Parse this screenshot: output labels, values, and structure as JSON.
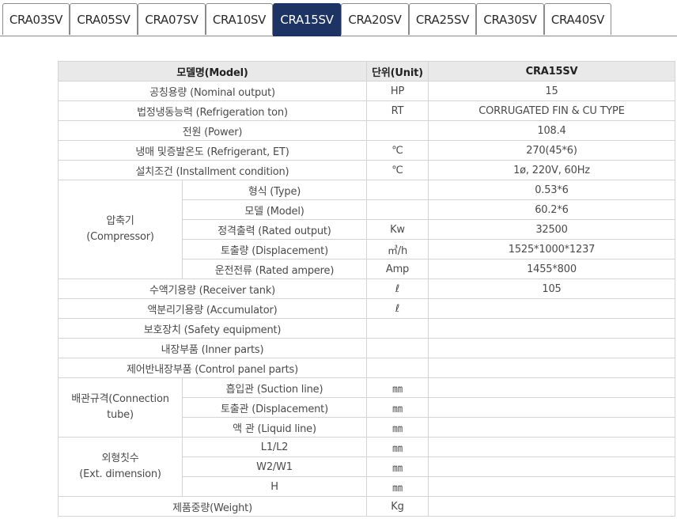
{
  "tabs": [
    {
      "label": "CRA03SV",
      "active": false
    },
    {
      "label": "CRA05SV",
      "active": false
    },
    {
      "label": "CRA07SV",
      "active": false
    },
    {
      "label": "CRA10SV",
      "active": false
    },
    {
      "label": "CRA15SV",
      "active": true
    },
    {
      "label": "CRA20SV",
      "active": false
    },
    {
      "label": "CRA25SV",
      "active": false
    },
    {
      "label": "CRA30SV",
      "active": false
    },
    {
      "label": "CRA40SV",
      "active": false
    }
  ],
  "colors": {
    "active_tab": "#1c3363",
    "header_bg": "#e9e9e9",
    "border": "#d4d4d4"
  },
  "table": {
    "header": {
      "model": "모델명(Model)",
      "unit": "단위(Unit)",
      "value": "CRA15SV"
    },
    "rows": [
      {
        "label": "공칭용량 (Nominal output)",
        "unit": "HP",
        "value": "15"
      },
      {
        "label": "법정냉동능력 (Refrigeration ton)",
        "unit": "RT",
        "value": "CORRUGATED FIN & CU TYPE"
      },
      {
        "label": "전원 (Power)",
        "unit": "",
        "value": "108.4"
      },
      {
        "label": "냉매 및증발온도 (Refrigerant, ET)",
        "unit": "℃",
        "value": "270(45*6)"
      },
      {
        "label": "설치조건 (Installment condition)",
        "unit": "℃",
        "value": "1ø, 220V, 60Hz"
      },
      {
        "group": "압축기\n(Compressor)",
        "label": "형식 (Type)",
        "unit": "",
        "value": "0.53*6"
      },
      {
        "label": "모델 (Model)",
        "unit": "",
        "value": "60.2*6"
      },
      {
        "label": "정격출력 (Rated output)",
        "unit": "Kw",
        "value": "32500"
      },
      {
        "label": "토출량 (Displacement)",
        "unit": "㎥/h",
        "value": "1525*1000*1237"
      },
      {
        "label": "운전전류 (Rated ampere)",
        "unit": "Amp",
        "value": "1455*800"
      },
      {
        "label": "수액기용량 (Receiver tank)",
        "unit": "ℓ",
        "value": "105"
      },
      {
        "label": "액분리기용량 (Accumulator)",
        "unit": "ℓ",
        "value": ""
      },
      {
        "label": "보호장치 (Safety equipment)",
        "unit": "",
        "value": ""
      },
      {
        "label": "내장부품 (Inner parts)",
        "unit": "",
        "value": ""
      },
      {
        "label": "제어반내장부품 (Control panel parts)",
        "unit": "",
        "value": ""
      },
      {
        "group": "배관규격(Connection\ntube)",
        "label": "흡입관 (Suction line)",
        "unit": "㎜",
        "value": ""
      },
      {
        "label": "토출관 (Displacement)",
        "unit": "㎜",
        "value": ""
      },
      {
        "label": "액 관 (Liquid line)",
        "unit": "㎜",
        "value": ""
      },
      {
        "group": "외형칫수\n(Ext. dimension)",
        "label": "L1/L2",
        "unit": "㎜",
        "value": ""
      },
      {
        "label": "W2/W1",
        "unit": "㎜",
        "value": ""
      },
      {
        "label": "H",
        "unit": "㎜",
        "value": ""
      },
      {
        "label": "제품중량(Weight)",
        "unit": "Kg",
        "value": ""
      }
    ]
  }
}
